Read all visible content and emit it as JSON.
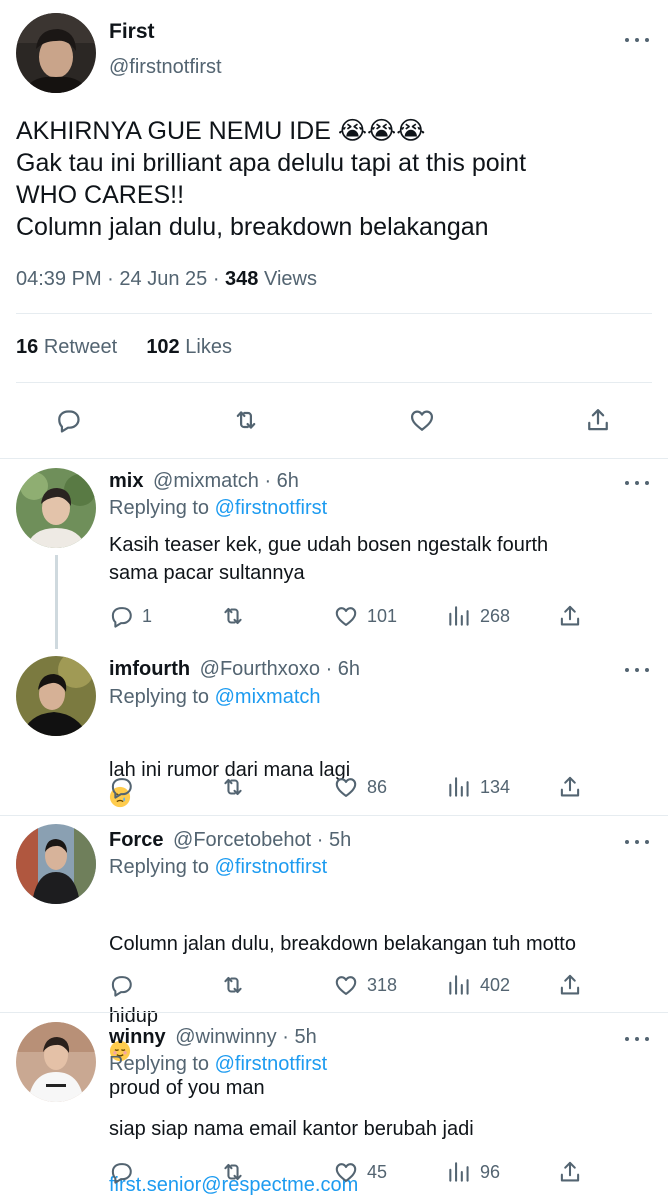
{
  "main_tweet": {
    "author_name": "First",
    "author_handle": "@firstnotfirst",
    "text_line1": "AKHIRNYA GUE NEMU IDE 😭😭😭",
    "text_rest": "Gak tau ini brilliant apa delulu tapi at this point\nWHO CARES!!\nColumn jalan dulu, breakdown belakangan",
    "time": "04:39 PM",
    "date": "24 Jun 25",
    "views_count": "348",
    "views_label": "Views",
    "retweet_count": "16",
    "retweet_label": "Retweet",
    "likes_count": "102",
    "likes_label": "Likes",
    "actions": [
      "reply-icon",
      "retweet-icon",
      "like-icon",
      "share-icon"
    ]
  },
  "replies": [
    {
      "name": "mix",
      "handle": "@mixmatch",
      "time": "· 6h",
      "replying_label": "Replying to",
      "replying_to": "@firstnotfirst",
      "text": "Kasih teaser kek, gue udah bosen ngestalk fourth\nsama pacar sultannya",
      "reply_count": "1",
      "retweet_count": "",
      "like_count": "101",
      "view_count": "268"
    },
    {
      "name": "imfourth",
      "handle": "@Fourthxoxo",
      "time": "· 6h",
      "replying_label": "Replying to",
      "replying_to": "@mixmatch",
      "text": "lah ini rumor dari mana lagi",
      "reply_count": "",
      "retweet_count": "",
      "like_count": "86",
      "view_count": "134"
    },
    {
      "name": "Force",
      "handle": "@Forcetobehot",
      "time": "· 5h",
      "replying_label": "Replying to",
      "replying_to": "@firstnotfirst",
      "text_line1": "Column jalan dulu, breakdown belakangan tuh motto",
      "text_line2a": "hidup",
      "text_line2b": "proud of you man",
      "reply_count": "",
      "retweet_count": "",
      "like_count": "318",
      "view_count": "402"
    },
    {
      "name": "winny",
      "handle": "@winwinny",
      "time": "· 5h",
      "replying_label": "Replying to",
      "replying_to": "@firstnotfirst",
      "text": "siap siap nama email kantor berubah jadi",
      "link": "first.senior@respectme.com",
      "reply_count": "",
      "retweet_count": "",
      "like_count": "45",
      "view_count": "96"
    }
  ],
  "colors": {
    "text": "#0f1419",
    "secondary": "#536471",
    "link": "#1d9bf0",
    "divider": "#e6ecf0"
  }
}
